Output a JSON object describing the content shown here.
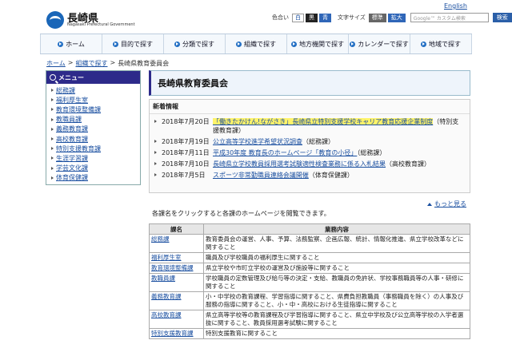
{
  "header": {
    "site_name": "長崎県",
    "site_subtitle": "Nagasaki Prefectural Government",
    "top_link": "English",
    "color_label": "色合い",
    "color_options": [
      "白",
      "黒",
      "青"
    ],
    "textsize_label": "文字サイズ",
    "textsize_options": [
      "標準",
      "拡大"
    ],
    "search_placeholder": "Google™ カスタム検索",
    "search_button": "検索"
  },
  "nav": [
    "ホーム",
    "目的で探す",
    "分類で探す",
    "組織で探す",
    "地方機関で探す",
    "カレンダーで探す",
    "地域で探す"
  ],
  "breadcrumb": [
    "ホーム",
    "組織で探す",
    "長崎県教育委員会"
  ],
  "sidebar": {
    "title": "メニュー",
    "items": [
      "総務課",
      "福利厚生室",
      "教育環境整備課",
      "教職員課",
      "義務教育課",
      "高校教育課",
      "特別支援教育課",
      "生涯学習課",
      "学芸文化課",
      "体育保健課"
    ]
  },
  "page_title": "長崎県教育委員会",
  "news": {
    "heading": "新着情報",
    "items": [
      {
        "date": "2018年7月20日",
        "link": "「働きたかけん!ながさき」長崎県立特別支援学校キャリア教育応援企業制度",
        "note": "（特別支援教育課）",
        "highlight": true
      },
      {
        "date": "2018年7月19日",
        "link": "公立高等学校進学希望状況調査",
        "note": "（総務課）",
        "highlight": false
      },
      {
        "date": "2018年7月11日",
        "link": "平成30年度 教育長のホームページ「教育の小径」",
        "note": "（総務課）",
        "highlight": false
      },
      {
        "date": "2018年7月10日",
        "link": "長崎県立学校教員採用選考試験適性検査業務に係る入札結果",
        "note": "（高校教育課）",
        "highlight": false
      },
      {
        "date": "2018年7月5日",
        "link": "スポーツ非常勤職員連絡会議開催",
        "note": "（体育保健課）",
        "highlight": false
      }
    ]
  },
  "back_to_top": "もっと見る",
  "intro_text": "各課名をクリックすると各課のホームページを閲覧できます。",
  "table": {
    "headers": [
      "課名",
      "業務内容"
    ],
    "rows": [
      {
        "name": "総務課",
        "desc": "教育委員会の運営、人事、予算、法務監察、企画広報、統計、情報化推進、県立学校改革などに関すること"
      },
      {
        "name": "福利厚生室",
        "desc": "職員及び学校職員の福利厚生に関すること"
      },
      {
        "name": "教育環境整備課",
        "desc": "県立学校や市町立学校の運営及び施設等に関すること"
      },
      {
        "name": "教職員課",
        "desc": "学校職員の定数管理及び給与等の決定・支給、教職員の免許状、学校事務職員等の人事・研修に関すること"
      },
      {
        "name": "義務教育課",
        "desc": "小・中学校の教育課程、学習指導に関すること、県費負担教職員（事務職員を除く）の人事及び服務の指導に関すること、小・中・高校における生徒指導に関すること"
      },
      {
        "name": "高校教育課",
        "desc": "県立高等学校等の教育課程及び学習指導に関すること、県立中学校及び公立高等学校の入学者選抜に関すること、教員採用選考試験に関すること"
      },
      {
        "name": "特別支援教育課",
        "desc": "特別支援教育に関すること"
      }
    ]
  }
}
